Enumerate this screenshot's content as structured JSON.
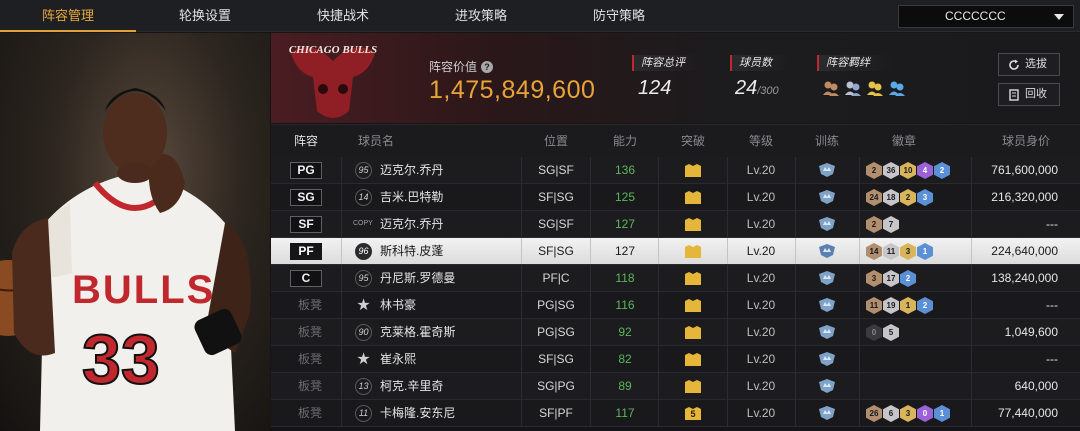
{
  "nav": {
    "tabs": [
      "阵容管理",
      "轮换设置",
      "快捷战术",
      "进攻策略",
      "防守策略"
    ],
    "active_tab": 0,
    "team_select": "CCCCCCC"
  },
  "header": {
    "logo_text": "CHICAGO BULLS",
    "value_label": "阵容价值",
    "value": "1,475,849,600",
    "overall_label": "阵容总评",
    "overall": "124",
    "players_label": "球员数",
    "players": "24",
    "players_max": "/300",
    "bonds_label": "阵容羁绊",
    "swap_button": "选拔",
    "recall_button": "回收"
  },
  "columns": [
    "阵容",
    "球员名",
    "位置",
    "能力",
    "突破",
    "等级",
    "训练",
    "徽章",
    "球员身价"
  ],
  "rows": [
    {
      "slot": "PG",
      "slot_type": "pos",
      "jersey": "95",
      "name": "迈克尔.乔丹",
      "position": "SG|SF",
      "ability": "136",
      "breakthrough": "",
      "level": "Lv.20",
      "badges": [
        {
          "v": "2",
          "c": "b-bronze"
        },
        {
          "v": "36",
          "c": "b-silver"
        },
        {
          "v": "10",
          "c": "b-gold"
        },
        {
          "v": "4",
          "c": "b-purple"
        },
        {
          "v": "2",
          "c": "b-blue"
        }
      ],
      "salary": "761,600,000"
    },
    {
      "slot": "SG",
      "slot_type": "pos",
      "jersey": "14",
      "name": "吉米.巴特勒",
      "position": "SF|SG",
      "ability": "125",
      "breakthrough": "",
      "level": "Lv.20",
      "badges": [
        {
          "v": "24",
          "c": "b-bronze"
        },
        {
          "v": "18",
          "c": "b-silver"
        },
        {
          "v": "2",
          "c": "b-gold"
        },
        {
          "v": "3",
          "c": "b-blue"
        }
      ],
      "salary": "216,320,000"
    },
    {
      "slot": "SF",
      "slot_type": "pos",
      "jersey": "COPY",
      "name": "迈克尔.乔丹",
      "position": "SG|SF",
      "ability": "127",
      "breakthrough": "",
      "level": "Lv.20",
      "badges": [
        {
          "v": "2",
          "c": "b-bronze"
        },
        {
          "v": "7",
          "c": "b-silver"
        }
      ],
      "salary": "---"
    },
    {
      "slot": "PF",
      "slot_type": "pos",
      "jersey": "96",
      "name": "斯科特.皮蓬",
      "position": "SF|SG",
      "ability": "127",
      "breakthrough": "",
      "level": "Lv.20",
      "badges": [
        {
          "v": "14",
          "c": "b-bronze"
        },
        {
          "v": "11",
          "c": "b-silver"
        },
        {
          "v": "3",
          "c": "b-gold"
        },
        {
          "v": "1",
          "c": "b-blue"
        }
      ],
      "salary": "224,640,000",
      "selected": true
    },
    {
      "slot": "C",
      "slot_type": "pos",
      "jersey": "95",
      "name": "丹尼斯.罗德曼",
      "position": "PF|C",
      "ability": "118",
      "breakthrough": "",
      "level": "Lv.20",
      "badges": [
        {
          "v": "3",
          "c": "b-bronze"
        },
        {
          "v": "17",
          "c": "b-silver"
        },
        {
          "v": "2",
          "c": "b-blue"
        }
      ],
      "salary": "138,240,000"
    },
    {
      "slot": "板凳",
      "slot_type": "bench",
      "jersey": "★",
      "name": "林书豪",
      "position": "PG|SG",
      "ability": "116",
      "breakthrough": "",
      "level": "Lv.20",
      "badges": [
        {
          "v": "11",
          "c": "b-bronze"
        },
        {
          "v": "19",
          "c": "b-silver"
        },
        {
          "v": "1",
          "c": "b-gold"
        },
        {
          "v": "2",
          "c": "b-blue"
        }
      ],
      "salary": "---"
    },
    {
      "slot": "板凳",
      "slot_type": "bench",
      "jersey": "90",
      "name": "克莱格.霍奇斯",
      "position": "PG|SG",
      "ability": "92",
      "breakthrough": "",
      "level": "Lv.20",
      "badges": [
        {
          "v": "0",
          "c": "b-black"
        },
        {
          "v": "5",
          "c": "b-silver"
        }
      ],
      "salary": "1,049,600"
    },
    {
      "slot": "板凳",
      "slot_type": "bench",
      "jersey": "★",
      "name": "崔永熙",
      "position": "SF|SG",
      "ability": "82",
      "breakthrough": "",
      "level": "Lv.20",
      "badges": [],
      "salary": "---"
    },
    {
      "slot": "板凳",
      "slot_type": "bench",
      "jersey": "13",
      "name": "柯克.辛里奇",
      "position": "SG|PG",
      "ability": "89",
      "breakthrough": "",
      "level": "Lv.20",
      "badges": [],
      "salary": "640,000"
    },
    {
      "slot": "板凳",
      "slot_type": "bench",
      "jersey": "11",
      "name": "卡梅隆.安东尼",
      "position": "SF|PF",
      "ability": "117",
      "breakthrough": "5",
      "level": "Lv.20",
      "badges": [
        {
          "v": "26",
          "c": "b-bronze"
        },
        {
          "v": "6",
          "c": "b-silver"
        },
        {
          "v": "3",
          "c": "b-gold"
        },
        {
          "v": "0",
          "c": "b-purple"
        },
        {
          "v": "1",
          "c": "b-blue"
        }
      ],
      "salary": "77,440,000"
    }
  ],
  "colors": {
    "accent": "#e9a437",
    "ability_green": "#5bb55d",
    "team_red": "#c0282d"
  }
}
